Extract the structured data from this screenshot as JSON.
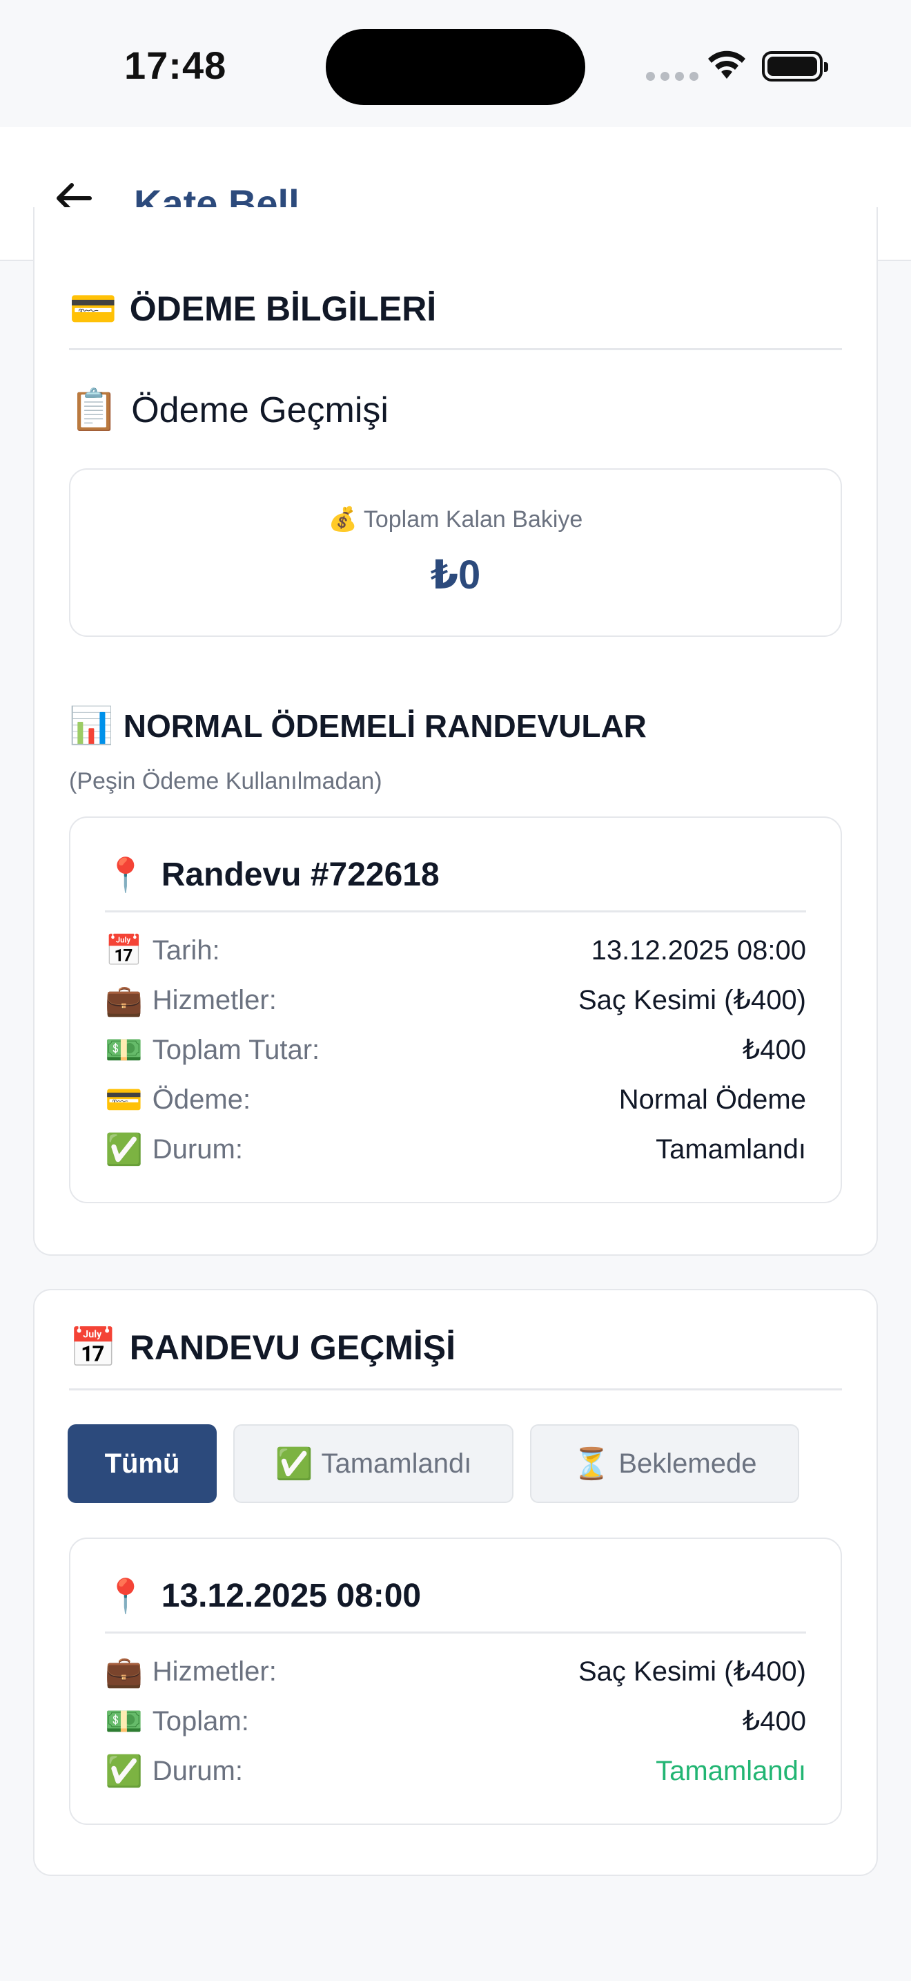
{
  "status_bar": {
    "time": "17:48"
  },
  "header": {
    "title": "Kate Bell"
  },
  "payment_info": {
    "title": "ÖDEME BİLGİLERİ",
    "title_icon": "credit-card",
    "history_title": "Ödeme Geçmişi",
    "history_icon": "clipboard",
    "balance_label": "Toplam Kalan Bakiye",
    "balance_icon": "money-bag",
    "balance_value": "₺0",
    "normal_title": "NORMAL ÖDEMELİ RANDEVULAR",
    "normal_icon": "bar-chart",
    "normal_note": "(Peşin Ödeme Kullanılmadan)",
    "appointment": {
      "title": "Randevu #722618",
      "rows": [
        {
          "icon": "calendar",
          "label": "Tarih:",
          "value": "13.12.2025 08:00"
        },
        {
          "icon": "briefcase",
          "label": "Hizmetler:",
          "value": "Saç Kesimi (₺400)"
        },
        {
          "icon": "money",
          "label": "Toplam Tutar:",
          "value": "₺400"
        },
        {
          "icon": "credit-card",
          "label": "Ödeme:",
          "value": "Normal Ödeme"
        },
        {
          "icon": "check",
          "label": "Durum:",
          "value": "Tamamlandı"
        }
      ]
    }
  },
  "appointment_history": {
    "title": "RANDEVU GEÇMİŞİ",
    "title_icon": "calendar",
    "tabs": [
      {
        "label": "Tümü",
        "icon": "",
        "active": true
      },
      {
        "label": "Tamamlandı",
        "icon": "check",
        "active": false
      },
      {
        "label": "Beklemede",
        "icon": "hourglass",
        "active": false
      }
    ],
    "item": {
      "title": "13.12.2025 08:00",
      "rows": [
        {
          "icon": "briefcase",
          "label": "Hizmetler:",
          "value": "Saç Kesimi (₺400)"
        },
        {
          "icon": "money",
          "label": "Toplam:",
          "value": "₺400"
        },
        {
          "icon": "check",
          "label": "Durum:",
          "value": "Tamamlandı"
        }
      ]
    }
  },
  "colors": {
    "primary": "#2c4a7c",
    "success": "#22b573",
    "muted": "#6b7280"
  }
}
